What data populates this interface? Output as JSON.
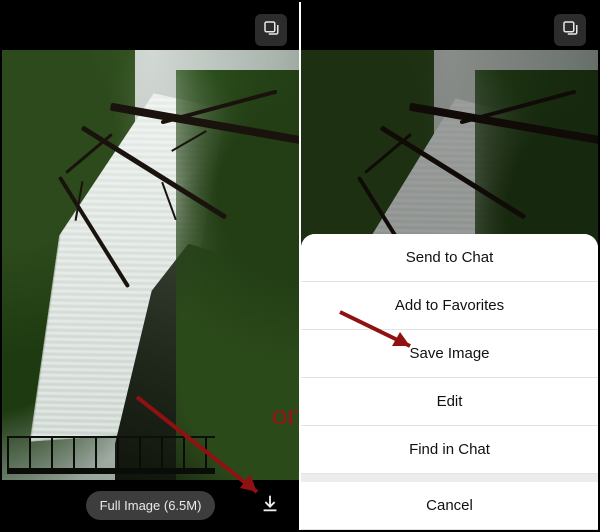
{
  "left": {
    "full_image_label": "Full Image (6.5M)"
  },
  "menu": {
    "items": [
      "Send to Chat",
      "Add to Favorites",
      "Save Image",
      "Edit",
      "Find in Chat"
    ],
    "cancel": "Cancel"
  },
  "annotation": {
    "or": "or"
  },
  "colors": {
    "annotation": "#8f1111"
  }
}
